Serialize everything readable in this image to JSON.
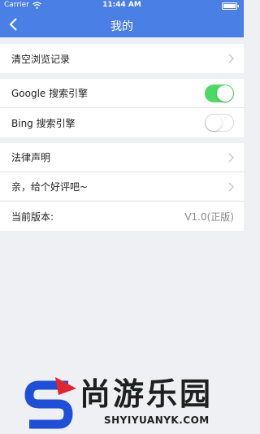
{
  "status_bar": {
    "carrier": "Carrier",
    "time": "11:44 AM"
  },
  "nav": {
    "title": "我的"
  },
  "groups": [
    {
      "rows": [
        {
          "label": "清空浏览记录"
        }
      ]
    },
    {
      "rows": [
        {
          "label": "Google 搜索引擎",
          "toggle_on": true
        },
        {
          "label": "Bing 搜索引擎",
          "toggle_on": false
        }
      ]
    },
    {
      "rows": [
        {
          "label": "法律声明"
        },
        {
          "label": "亲，给个好评吧~"
        },
        {
          "label": "当前版本:",
          "value": "V1.0(正版)"
        }
      ]
    }
  ],
  "watermark": {
    "name": "尚游乐园",
    "url": "SHYIYUANYK.COM"
  },
  "colors": {
    "nav_bar": "#4a7fe5",
    "toggle_on": "#4cd964",
    "background": "#eff0f4",
    "watermark_accent": "#1e4fd8"
  },
  "icons": [
    "wifi-icon",
    "battery-icon",
    "back-arrow-icon",
    "chevron-right-icon"
  ]
}
